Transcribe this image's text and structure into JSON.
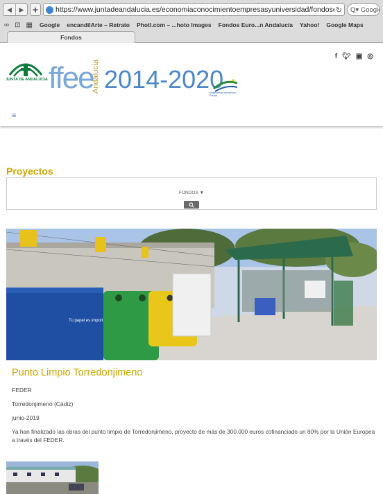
{
  "browser": {
    "url": "https://www.juntadeandalucia.es/economiaconocimientoempresasyuniversidad/fondoseurop",
    "search_placeholder": "Q▾ Google",
    "bookmarks": [
      "Google",
      "encandilArte – Retrato",
      "Photl.com – ...hoto Images",
      "Fondos Euro...n Andalucía",
      "Yahoo!",
      "Google Maps"
    ],
    "tab_title": "Fondos"
  },
  "header": {
    "junta_name": "JUNTA DE ANDALUCIA",
    "brand": "ffee",
    "region": "Andalucía",
    "period": "2014-2020",
    "eu_tagline": "Andalucía se mueve con Europa",
    "social_icons": [
      "facebook-icon",
      "twitter-icon",
      "youtube-icon",
      "instagram-icon"
    ]
  },
  "section": {
    "title": "Proyectos",
    "filter_label": "FONDOS ▼"
  },
  "project": {
    "title": "Punto Limpio Torredonjimeno",
    "fund": "FEDER",
    "location": "Torredonjimeno (Cádiz)",
    "date": "junio-2019",
    "description": "Ya han finalizado las obras del punto limpio de Torredonjimeno, proyecto de más de 300.000 euros cofinanciado un 80% por la Unión Europea a través del FEDER.",
    "sign_text": "Tu papel es importante"
  },
  "colors": {
    "accent_gold": "#c9a600",
    "brand_blue": "#4d87c6",
    "junta_green": "#0b7a3b"
  }
}
